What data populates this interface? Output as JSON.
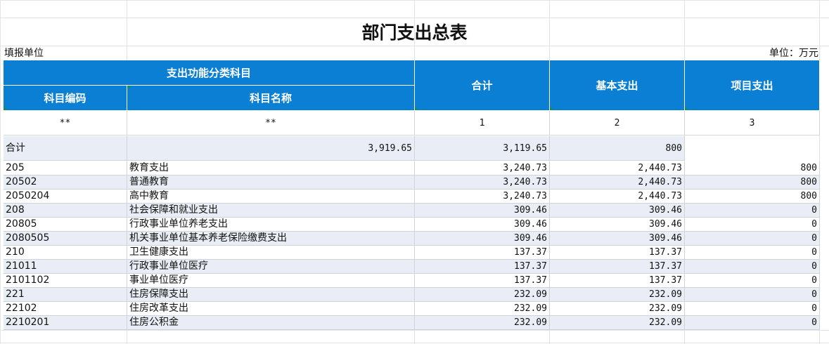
{
  "title": "部门支出总表",
  "fill_unit_label": "填报单位",
  "unit_label": "单位：万元",
  "header": {
    "group_label": "支出功能分类科目",
    "code_label": "科目编码",
    "name_label": "科目名称",
    "total_label": "合计",
    "basic_label": "基本支出",
    "project_label": "项目支出"
  },
  "index_row": [
    "**",
    "**",
    "1",
    "2",
    "3"
  ],
  "total_row": {
    "label": "合计",
    "total": "3,919.65",
    "basic": "3,119.65",
    "project": "800"
  },
  "rows": [
    {
      "code": "205",
      "name": "教育支出",
      "total": "3,240.73",
      "basic": "2,440.73",
      "project": "800"
    },
    {
      "code": "20502",
      "name": "普通教育",
      "total": "3,240.73",
      "basic": "2,440.73",
      "project": "800"
    },
    {
      "code": "2050204",
      "name": "高中教育",
      "total": "3,240.73",
      "basic": "2,440.73",
      "project": "800"
    },
    {
      "code": "208",
      "name": "社会保障和就业支出",
      "total": "309.46",
      "basic": "309.46",
      "project": "0"
    },
    {
      "code": "20805",
      "name": "行政事业单位养老支出",
      "total": "309.46",
      "basic": "309.46",
      "project": "0"
    },
    {
      "code": "2080505",
      "name": "机关事业单位基本养老保险缴费支出",
      "total": "309.46",
      "basic": "309.46",
      "project": "0"
    },
    {
      "code": "210",
      "name": "卫生健康支出",
      "total": "137.37",
      "basic": "137.37",
      "project": "0"
    },
    {
      "code": "21011",
      "name": "行政事业单位医疗",
      "total": "137.37",
      "basic": "137.37",
      "project": "0"
    },
    {
      "code": "2101102",
      "name": "事业单位医疗",
      "total": "137.37",
      "basic": "137.37",
      "project": "0"
    },
    {
      "code": "221",
      "name": "住房保障支出",
      "total": "232.09",
      "basic": "232.09",
      "project": "0"
    },
    {
      "code": "22102",
      "name": "住房改革支出",
      "total": "232.09",
      "basic": "232.09",
      "project": "0"
    },
    {
      "code": "2210201",
      "name": "住房公积金",
      "total": "232.09",
      "basic": "232.09",
      "project": "0"
    }
  ],
  "colors": {
    "header_bg": "#0b7fd4",
    "header_text": "#ffffff",
    "shade_row": "#e9edf5"
  }
}
